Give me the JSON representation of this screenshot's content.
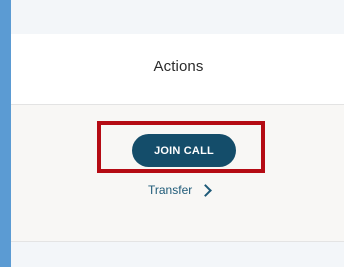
{
  "table": {
    "header": {
      "actions_label": "Actions"
    },
    "row": {
      "join_call_label": "JOIN CALL",
      "transfer_label": "Transfer",
      "transfer_icon": "chevron-right-icon"
    }
  },
  "colors": {
    "join_button_bg": "#144d6a",
    "link_color": "#1e5a78",
    "highlight_border": "#b50b14",
    "frame_blue": "#5b9bd3"
  }
}
